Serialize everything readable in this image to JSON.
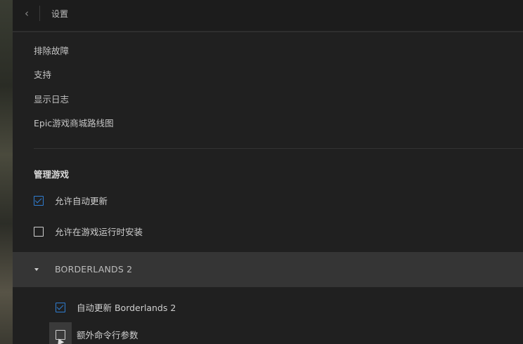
{
  "header": {
    "back_icon": "chevron-left-icon",
    "title": "设置"
  },
  "links": [
    {
      "label": "排除故障"
    },
    {
      "label": "支持"
    },
    {
      "label": "显示日志"
    },
    {
      "label": "Epic游戏商城路线图"
    }
  ],
  "manage_games": {
    "heading": "管理游戏",
    "allow_auto_update": {
      "label": "允许自动更新",
      "checked": true
    },
    "allow_install_while_playing": {
      "label": "允许在游戏运行时安装",
      "checked": false
    }
  },
  "game": {
    "title": "BORDERLANDS 2",
    "expanded": true,
    "auto_update": {
      "label": "自动更新 Borderlands 2",
      "checked": true
    },
    "extra_args": {
      "label": "额外命令行参数",
      "checked": false
    }
  },
  "colors": {
    "accent": "#2f7dd1",
    "panel_bg": "#202020",
    "game_header_bg": "#353535"
  }
}
